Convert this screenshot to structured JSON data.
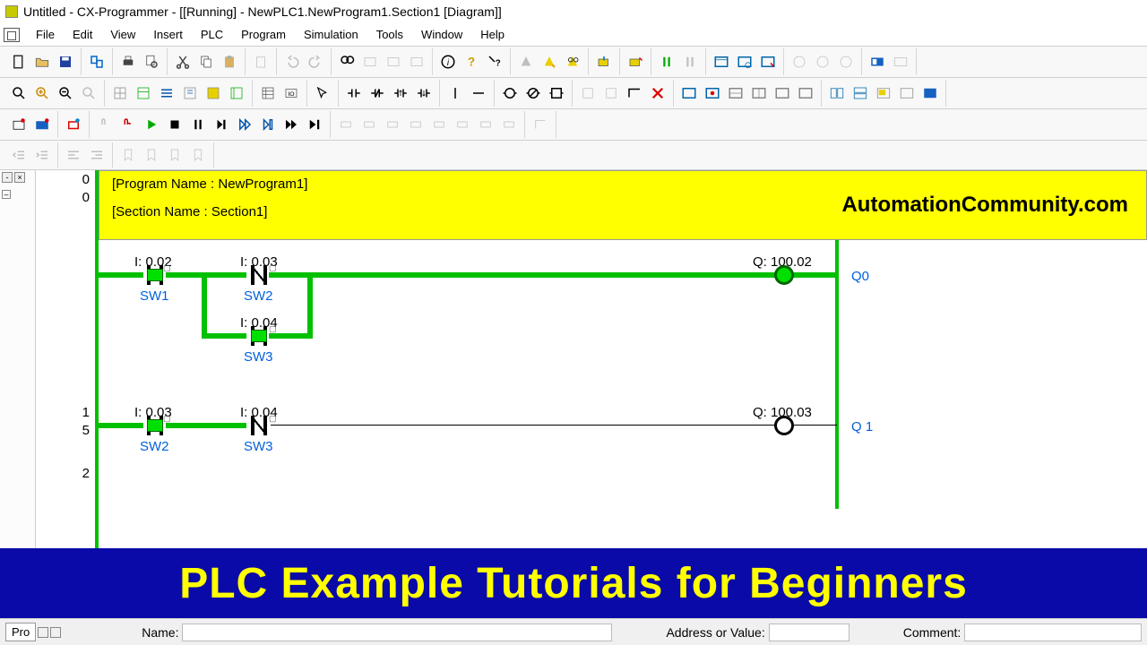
{
  "title": "Untitled - CX-Programmer - [[Running] - NewPLC1.NewProgram1.Section1 [Diagram]]",
  "menu": [
    "File",
    "Edit",
    "View",
    "Insert",
    "PLC",
    "Program",
    "Simulation",
    "Tools",
    "Window",
    "Help"
  ],
  "header": {
    "program_line": "[Program Name : NewProgram1]",
    "section_line": "[Section Name : Section1]",
    "watermark": "AutomationCommunity.com"
  },
  "rungs": {
    "r0": {
      "left_numbers": [
        "0",
        "0"
      ],
      "c1": {
        "addr": "I: 0.02",
        "name": "SW1",
        "closed": false,
        "energized": true
      },
      "c2": {
        "addr": "I: 0.03",
        "name": "SW2",
        "closed": true,
        "energized": true
      },
      "c3": {
        "addr": "I: 0.04",
        "name": "SW3",
        "closed": false,
        "energized": true
      },
      "coil": {
        "addr": "Q: 100.02",
        "name": "Q0",
        "energized": true
      }
    },
    "r1": {
      "left_numbers": [
        "1",
        "5"
      ],
      "c1": {
        "addr": "I: 0.03",
        "name": "SW2",
        "closed": false,
        "energized": true
      },
      "c2": {
        "addr": "I: 0.04",
        "name": "SW3",
        "closed": true,
        "energized": false
      },
      "coil": {
        "addr": "Q: 100.03",
        "name": "Q 1",
        "energized": false
      }
    },
    "r2": {
      "left_numbers": [
        "2"
      ]
    }
  },
  "banner": "PLC Example Tutorials for Beginners",
  "status": {
    "tab": "Pro",
    "name_label": "Name:",
    "addr_label": "Address or Value:",
    "comment_label": "Comment:"
  }
}
